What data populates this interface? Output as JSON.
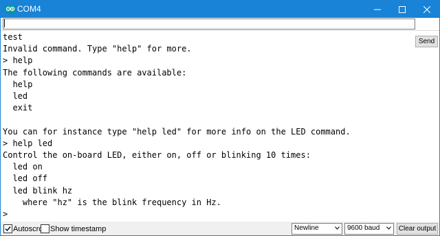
{
  "window": {
    "title": "COM4",
    "app_icon": "arduino-infinity-icon",
    "controls": [
      "minimize-icon",
      "maximize-icon",
      "close-icon"
    ]
  },
  "input": {
    "value": "",
    "placeholder": "",
    "send_label": "Send"
  },
  "output_lines": [
    "test",
    "Invalid command. Type \"help\" for more.",
    "> help",
    "The following commands are available:",
    "  help",
    "  led",
    "  exit",
    "",
    "You can for instance type \"help led\" for more info on the LED command.",
    "> help led",
    "Control the on-board LED, either on, off or blinking 10 times:",
    "  led on",
    "  led off",
    "  led blink hz",
    "    where \"hz\" is the blink frequency in Hz.",
    ">"
  ],
  "status": {
    "autoscroll_label": "Autoscroll",
    "autoscroll_checked": true,
    "timestamp_label": "Show timestamp",
    "timestamp_checked": false,
    "line_ending": "Newline",
    "baud_rate": "9600 baud",
    "clear_label": "Clear output"
  },
  "colors": {
    "titlebar": "#1883d7",
    "arduino_teal": "#00979d"
  }
}
